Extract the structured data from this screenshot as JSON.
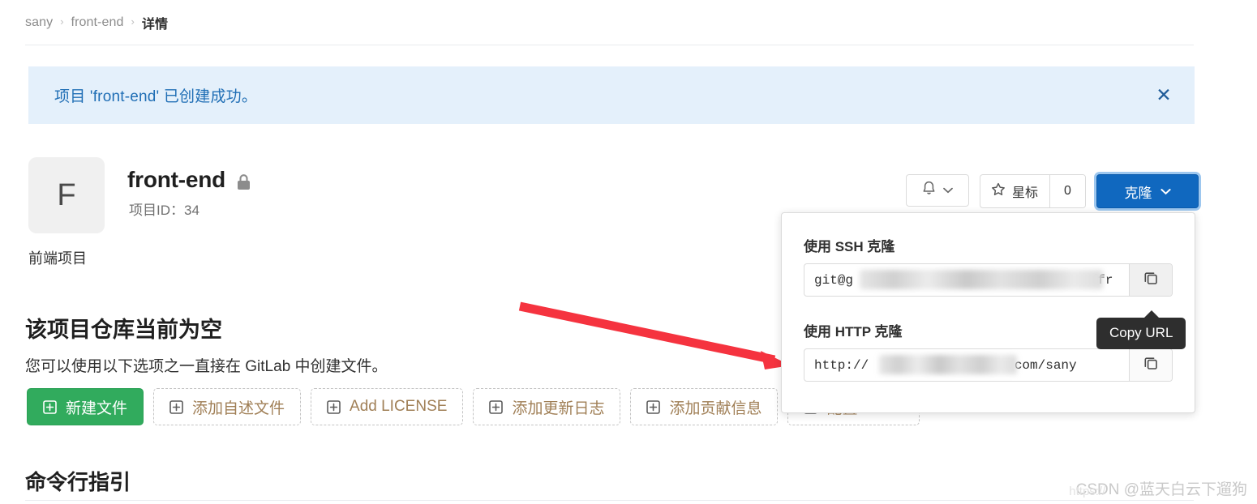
{
  "breadcrumb": {
    "items": [
      {
        "label": "sany"
      },
      {
        "label": "front-end"
      },
      {
        "label": "详情"
      }
    ],
    "separator": "›"
  },
  "alert": {
    "message": "项目 'front-end' 已创建成功。",
    "close_label": "✕",
    "background": "#e4f0fb",
    "text_color": "#1f6eb5"
  },
  "project": {
    "avatar_letter": "F",
    "name": "front-end",
    "visibility_icon": "lock-icon",
    "id_label": "项目ID：34",
    "description": "前端项目"
  },
  "header_actions": {
    "notify_icon": "bell-icon",
    "notify_caret": "chevron-down-icon",
    "star_icon": "star-icon",
    "star_label": "星标",
    "star_count": "0",
    "clone_label": "克隆",
    "clone_caret": "chevron-down-icon",
    "clone_color": "#1068bf"
  },
  "clone_dropdown": {
    "ssh_label": "使用 SSH 克隆",
    "ssh_url_prefix": "git@g",
    "ssh_url_suffix": "/fr",
    "http_label": "使用 HTTP 克隆",
    "http_url_prefix": "http://",
    "http_url_suffix": ".com/sany",
    "copy_icon": "copy-icon",
    "tooltip": "Copy URL"
  },
  "empty_repo": {
    "title": "该项目仓库当前为空",
    "subtitle": "您可以使用以下选项之一直接在 GitLab 中创建文件。",
    "buttons": [
      {
        "label": "新建文件",
        "icon": "plus-square-icon",
        "style": "primary"
      },
      {
        "label": "添加自述文件",
        "icon": "plus-square-icon",
        "style": "dashed"
      },
      {
        "label": "Add LICENSE",
        "icon": "plus-square-icon",
        "style": "dashed"
      },
      {
        "label": "添加更新日志",
        "icon": "plus-square-icon",
        "style": "dashed"
      },
      {
        "label": "添加贡献信息",
        "icon": "plus-square-icon",
        "style": "dashed"
      },
      {
        "label": "配置 CI/CD",
        "icon": "plus-square-icon",
        "style": "dashed"
      }
    ]
  },
  "cli_section": {
    "title": "命令行指引"
  },
  "annotation": {
    "arrow_color": "#f5333f"
  },
  "watermark": {
    "url_text": "https://",
    "text": "CSDN @蓝天白云下遛狗"
  }
}
